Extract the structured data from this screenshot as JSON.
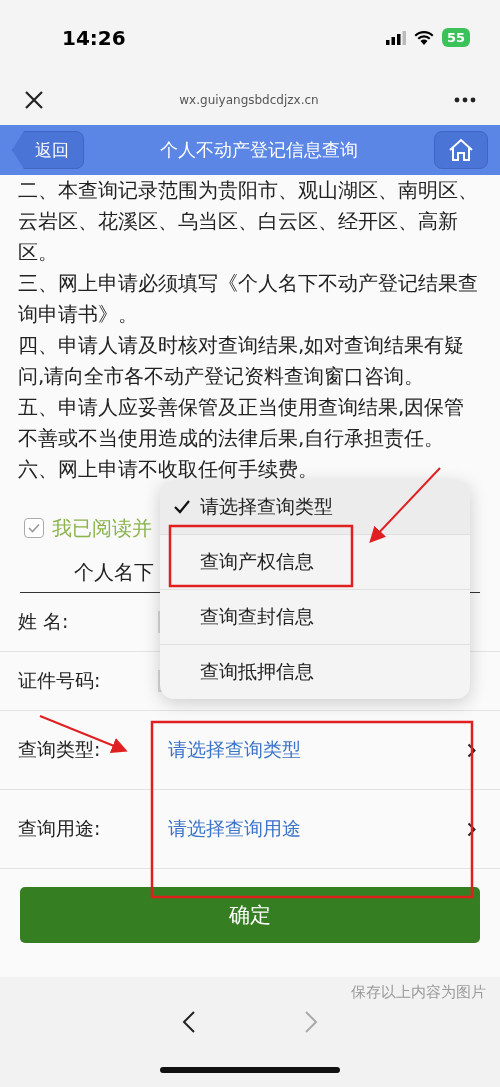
{
  "status_bar": {
    "time": "14:26",
    "battery": "55"
  },
  "browser": {
    "url": "wx.guiyangsbdcdjzx.cn"
  },
  "header": {
    "back": "返回",
    "title": "个人不动产登记信息查询"
  },
  "notice": [
    "二、本查询记录范围为贵阳市、观山湖区、南明区、云岩区、花溪区、乌当区、白云区、经开区、高新区。",
    "三、网上申请必须填写《个人名下不动产登记结果查询申请书》。",
    "四、申请人请及时核对查询结果,如对查询结果有疑问,请向全市各不动产登记资料查询窗口咨询。",
    "五、申请人应妥善保管及正当使用查询结果,因保管不善或不当使用造成的法律后果,自行承担责任。",
    "六、网上申请不收取任何手续费。"
  ],
  "agreement": {
    "label": "我已阅读并",
    "checked": true
  },
  "doc_field": {
    "value": "个人名下"
  },
  "form": [
    {
      "label": "姓 名:",
      "kind": "masked"
    },
    {
      "label": "证件号码:",
      "kind": "masked"
    },
    {
      "label": "查询类型:",
      "kind": "select",
      "value": "请选择查询类型"
    },
    {
      "label": "查询用途:",
      "kind": "select",
      "value": "请选择查询用途"
    }
  ],
  "menu": [
    {
      "label": "请选择查询类型",
      "selected": true
    },
    {
      "label": "查询产权信息",
      "selected": false
    },
    {
      "label": "查询查封信息",
      "selected": false
    },
    {
      "label": "查询抵押信息",
      "selected": false
    }
  ],
  "confirm_button": "确定",
  "save_hint": "保存以上内容为图片"
}
